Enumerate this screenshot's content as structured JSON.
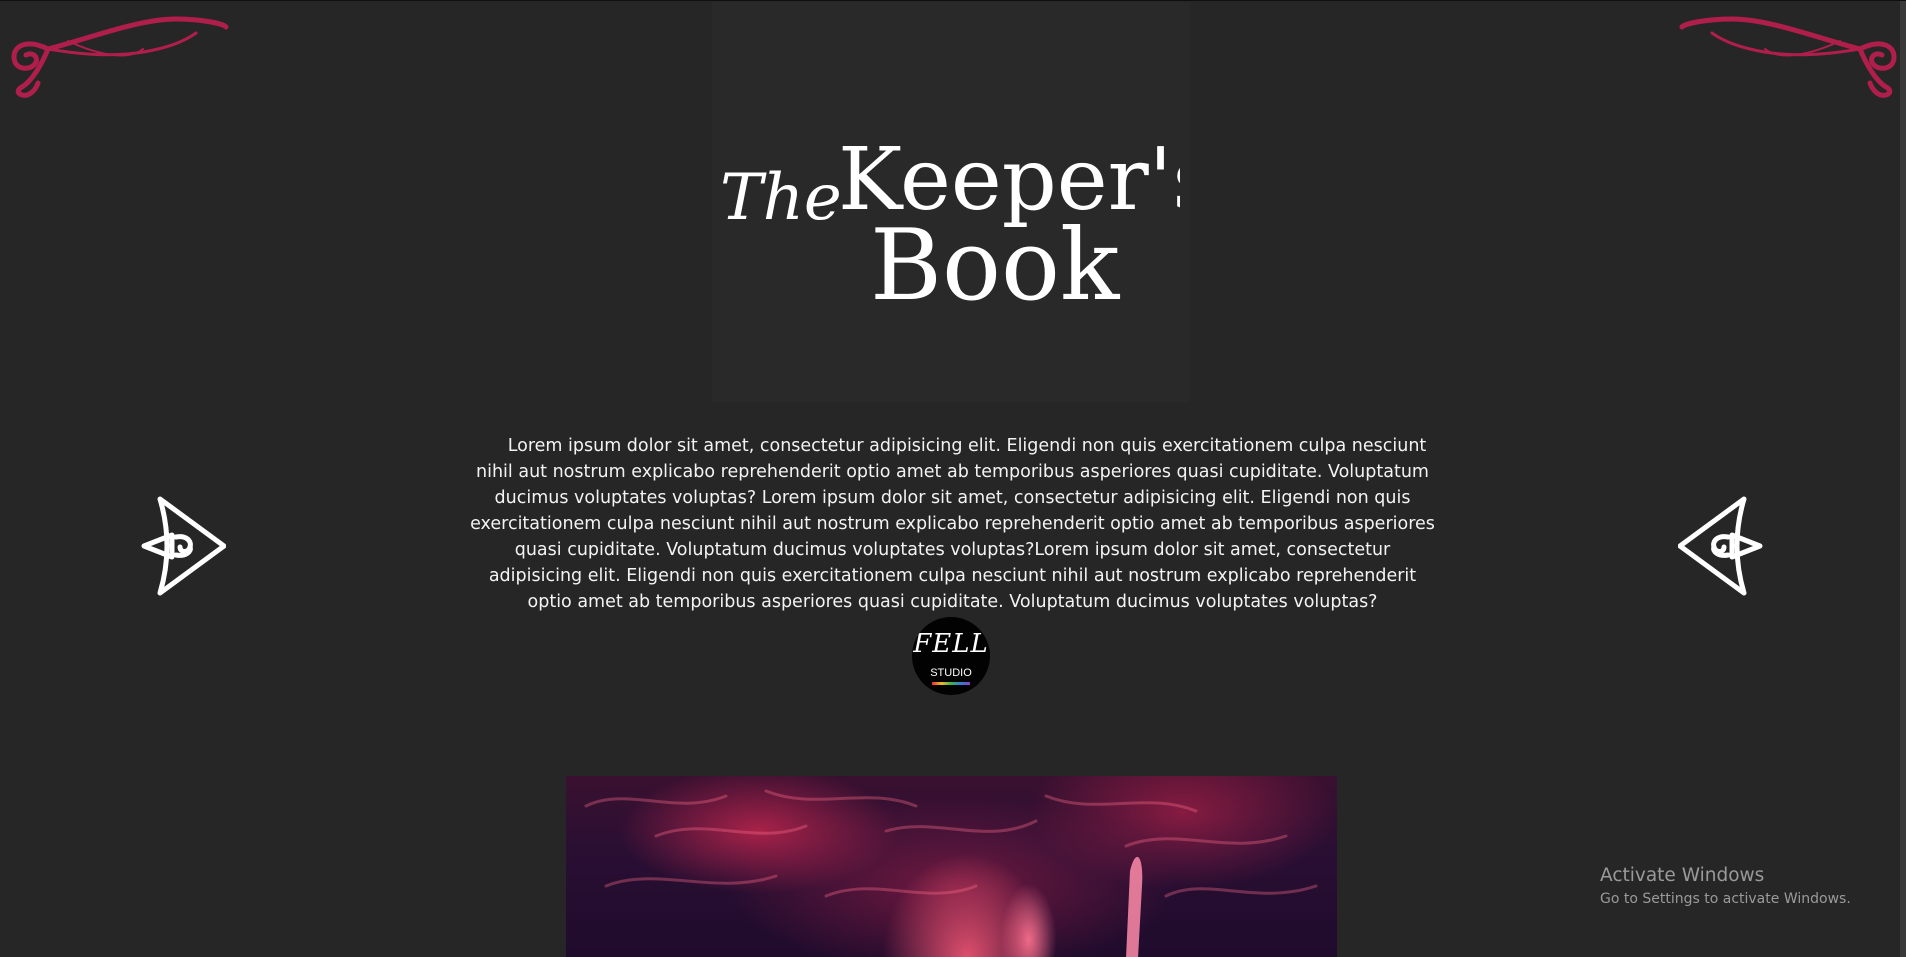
{
  "colors": {
    "background": "#262627",
    "accent": "#b01f4b",
    "text": "#f3f3f3"
  },
  "header": {
    "logo_text": "The Keeper's Book",
    "logo_line1_prefix": "The",
    "logo_line1_main": "Keeper's",
    "logo_line2": "Book"
  },
  "main": {
    "description": "Lorem ipsum dolor sit amet, consectetur adipisicing elit. Eligendi non quis exercitationem culpa nesciunt nihil aut nostrum explicabo reprehenderit optio amet ab temporibus asperiores quasi cupiditate. Voluptatum ducimus voluptates voluptas? Lorem ipsum dolor sit amet, consectetur adipisicing elit. Eligendi non quis exercitationem culpa nesciunt nihil aut nostrum explicabo reprehenderit optio amet ab temporibus asperiores quasi cupiditate. Voluptatum ducimus voluptates voluptas?Lorem ipsum dolor sit amet, consectetur adipisicing elit. Eligendi non quis exercitationem culpa nesciunt nihil aut nostrum explicabo reprehenderit optio amet ab temporibus asperiores quasi cupiditate. Voluptatum ducimus voluptates voluptas?",
    "studio_name": "FELL",
    "studio_sub": "STUDIO"
  },
  "nav": {
    "prev_icon": "ornate-arrow-left-icon",
    "next_icon": "ornate-arrow-left-icon"
  },
  "decor": {
    "corner_icon": "flourish-ornament-icon"
  },
  "os_overlay": {
    "title": "Activate Windows",
    "subtitle": "Go to Settings to activate Windows."
  }
}
